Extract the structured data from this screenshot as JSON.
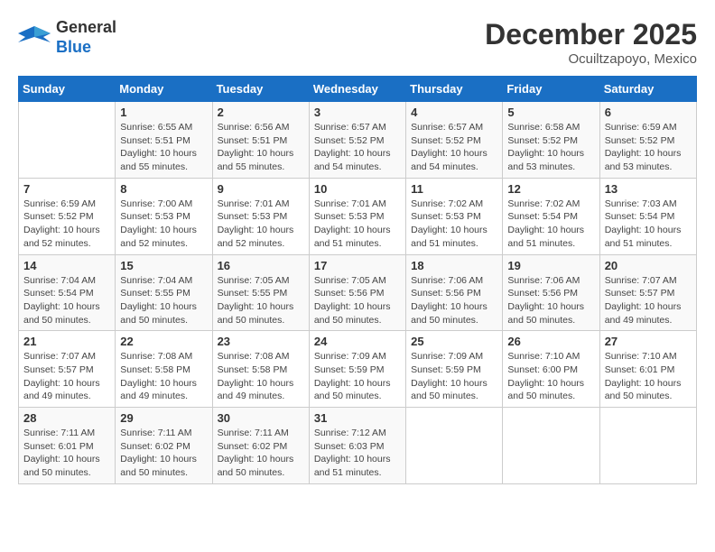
{
  "header": {
    "logo_line1": "General",
    "logo_line2": "Blue",
    "month": "December 2025",
    "location": "Ocuiltzapoyo, Mexico"
  },
  "weekdays": [
    "Sunday",
    "Monday",
    "Tuesday",
    "Wednesday",
    "Thursday",
    "Friday",
    "Saturday"
  ],
  "weeks": [
    [
      {
        "day": "",
        "sunrise": "",
        "sunset": "",
        "daylight": ""
      },
      {
        "day": "1",
        "sunrise": "6:55 AM",
        "sunset": "5:51 PM",
        "daylight": "10 hours and 55 minutes."
      },
      {
        "day": "2",
        "sunrise": "6:56 AM",
        "sunset": "5:51 PM",
        "daylight": "10 hours and 55 minutes."
      },
      {
        "day": "3",
        "sunrise": "6:57 AM",
        "sunset": "5:52 PM",
        "daylight": "10 hours and 54 minutes."
      },
      {
        "day": "4",
        "sunrise": "6:57 AM",
        "sunset": "5:52 PM",
        "daylight": "10 hours and 54 minutes."
      },
      {
        "day": "5",
        "sunrise": "6:58 AM",
        "sunset": "5:52 PM",
        "daylight": "10 hours and 53 minutes."
      },
      {
        "day": "6",
        "sunrise": "6:59 AM",
        "sunset": "5:52 PM",
        "daylight": "10 hours and 53 minutes."
      }
    ],
    [
      {
        "day": "7",
        "sunrise": "6:59 AM",
        "sunset": "5:52 PM",
        "daylight": "10 hours and 52 minutes."
      },
      {
        "day": "8",
        "sunrise": "7:00 AM",
        "sunset": "5:53 PM",
        "daylight": "10 hours and 52 minutes."
      },
      {
        "day": "9",
        "sunrise": "7:01 AM",
        "sunset": "5:53 PM",
        "daylight": "10 hours and 52 minutes."
      },
      {
        "day": "10",
        "sunrise": "7:01 AM",
        "sunset": "5:53 PM",
        "daylight": "10 hours and 51 minutes."
      },
      {
        "day": "11",
        "sunrise": "7:02 AM",
        "sunset": "5:53 PM",
        "daylight": "10 hours and 51 minutes."
      },
      {
        "day": "12",
        "sunrise": "7:02 AM",
        "sunset": "5:54 PM",
        "daylight": "10 hours and 51 minutes."
      },
      {
        "day": "13",
        "sunrise": "7:03 AM",
        "sunset": "5:54 PM",
        "daylight": "10 hours and 51 minutes."
      }
    ],
    [
      {
        "day": "14",
        "sunrise": "7:04 AM",
        "sunset": "5:54 PM",
        "daylight": "10 hours and 50 minutes."
      },
      {
        "day": "15",
        "sunrise": "7:04 AM",
        "sunset": "5:55 PM",
        "daylight": "10 hours and 50 minutes."
      },
      {
        "day": "16",
        "sunrise": "7:05 AM",
        "sunset": "5:55 PM",
        "daylight": "10 hours and 50 minutes."
      },
      {
        "day": "17",
        "sunrise": "7:05 AM",
        "sunset": "5:56 PM",
        "daylight": "10 hours and 50 minutes."
      },
      {
        "day": "18",
        "sunrise": "7:06 AM",
        "sunset": "5:56 PM",
        "daylight": "10 hours and 50 minutes."
      },
      {
        "day": "19",
        "sunrise": "7:06 AM",
        "sunset": "5:56 PM",
        "daylight": "10 hours and 50 minutes."
      },
      {
        "day": "20",
        "sunrise": "7:07 AM",
        "sunset": "5:57 PM",
        "daylight": "10 hours and 49 minutes."
      }
    ],
    [
      {
        "day": "21",
        "sunrise": "7:07 AM",
        "sunset": "5:57 PM",
        "daylight": "10 hours and 49 minutes."
      },
      {
        "day": "22",
        "sunrise": "7:08 AM",
        "sunset": "5:58 PM",
        "daylight": "10 hours and 49 minutes."
      },
      {
        "day": "23",
        "sunrise": "7:08 AM",
        "sunset": "5:58 PM",
        "daylight": "10 hours and 49 minutes."
      },
      {
        "day": "24",
        "sunrise": "7:09 AM",
        "sunset": "5:59 PM",
        "daylight": "10 hours and 50 minutes."
      },
      {
        "day": "25",
        "sunrise": "7:09 AM",
        "sunset": "5:59 PM",
        "daylight": "10 hours and 50 minutes."
      },
      {
        "day": "26",
        "sunrise": "7:10 AM",
        "sunset": "6:00 PM",
        "daylight": "10 hours and 50 minutes."
      },
      {
        "day": "27",
        "sunrise": "7:10 AM",
        "sunset": "6:01 PM",
        "daylight": "10 hours and 50 minutes."
      }
    ],
    [
      {
        "day": "28",
        "sunrise": "7:11 AM",
        "sunset": "6:01 PM",
        "daylight": "10 hours and 50 minutes."
      },
      {
        "day": "29",
        "sunrise": "7:11 AM",
        "sunset": "6:02 PM",
        "daylight": "10 hours and 50 minutes."
      },
      {
        "day": "30",
        "sunrise": "7:11 AM",
        "sunset": "6:02 PM",
        "daylight": "10 hours and 50 minutes."
      },
      {
        "day": "31",
        "sunrise": "7:12 AM",
        "sunset": "6:03 PM",
        "daylight": "10 hours and 51 minutes."
      },
      {
        "day": "",
        "sunrise": "",
        "sunset": "",
        "daylight": ""
      },
      {
        "day": "",
        "sunrise": "",
        "sunset": "",
        "daylight": ""
      },
      {
        "day": "",
        "sunrise": "",
        "sunset": "",
        "daylight": ""
      }
    ]
  ],
  "labels": {
    "sunrise": "Sunrise:",
    "sunset": "Sunset:",
    "daylight": "Daylight:"
  }
}
